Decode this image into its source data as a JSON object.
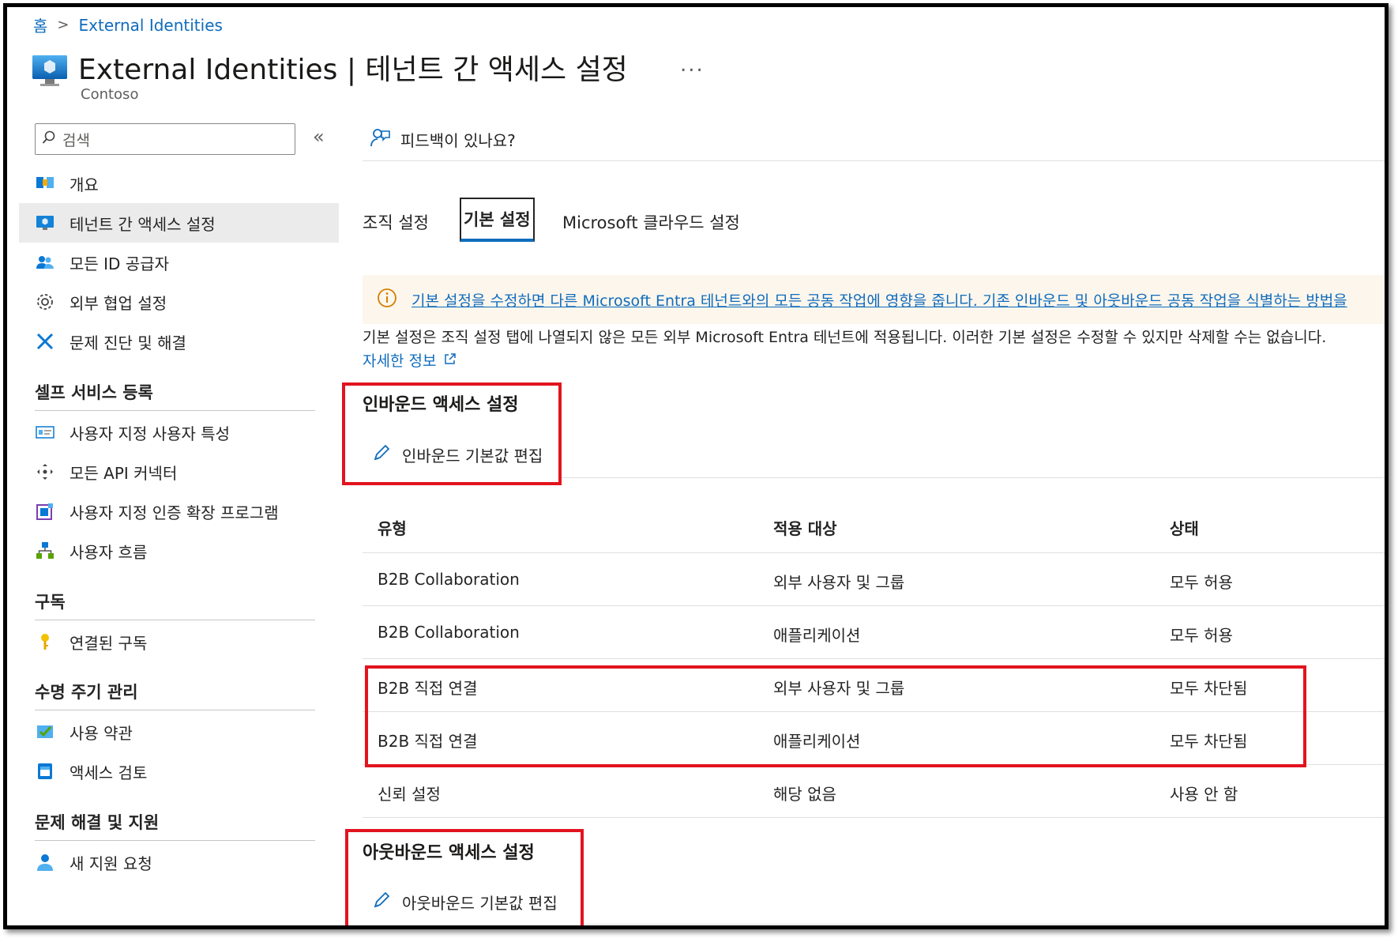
{
  "breadcrumb": {
    "home": "홈",
    "current": "External Identities"
  },
  "header": {
    "title": "External Identities | 테넌트 간 액세스 설정",
    "more": "...",
    "subtitle": "Contoso"
  },
  "sidebar": {
    "search_placeholder": "검색",
    "collapse": "«",
    "items": [
      {
        "label": "개요",
        "icon": "overview-icon"
      },
      {
        "label": "테넌트 간 액세스 설정",
        "icon": "monitor-icon",
        "active": true
      },
      {
        "label": "모든 ID 공급자",
        "icon": "users-icon"
      },
      {
        "label": "외부 협업 설정",
        "icon": "gear-icon"
      },
      {
        "label": "문제 진단 및 해결",
        "icon": "wrench-icon"
      }
    ],
    "sections": [
      {
        "title": "셀프 서비스 등록",
        "items": [
          {
            "label": "사용자 지정 사용자 특성",
            "icon": "attributes-icon"
          },
          {
            "label": "모든 API 커넥터",
            "icon": "connector-icon"
          },
          {
            "label": "사용자 지정 인증 확장 프로그램",
            "icon": "extension-icon"
          },
          {
            "label": "사용자 흐름",
            "icon": "flow-icon"
          }
        ]
      },
      {
        "title": "구독",
        "items": [
          {
            "label": "연결된 구독",
            "icon": "key-icon"
          }
        ]
      },
      {
        "title": "수명 주기 관리",
        "items": [
          {
            "label": "사용 약관",
            "icon": "checklist-icon"
          },
          {
            "label": "액세스 검토",
            "icon": "review-icon"
          }
        ]
      },
      {
        "title": "문제 해결 및 지원",
        "items": [
          {
            "label": "새 지원 요청",
            "icon": "support-icon"
          }
        ]
      }
    ]
  },
  "feedback": {
    "label": "피드백이 있나요?"
  },
  "tabs": [
    {
      "label": "조직 설정"
    },
    {
      "label": "기본 설정",
      "selected": true
    },
    {
      "label": "Microsoft 클라우드 설정"
    }
  ],
  "banner": {
    "text": "기본 설정을 수정하면 다른 Microsoft Entra 테넌트와의 모든 공동 작업에 영향을 줍니다. 기존 인바운드 및 아웃바운드 공동 작업을 식별하는 방법을"
  },
  "description": "기본 설정은 조직 설정 탭에 나열되지 않은 모든 외부 Microsoft Entra 테넌트에 적용됩니다. 이러한 기본 설정은 수정할 수 있지만 삭제할 수는 없습니다.",
  "learn_more": "자세한 정보",
  "inbound": {
    "title": "인바운드 액세스 설정",
    "edit": "인바운드 기본값 편집"
  },
  "outbound": {
    "title": "아웃바운드 액세스 설정",
    "edit": "아웃바운드 기본값 편집"
  },
  "table": {
    "headers": [
      "유형",
      "적용 대상",
      "상태"
    ],
    "rows": [
      [
        "B2B Collaboration",
        "외부 사용자 및 그룹",
        "모두 허용"
      ],
      [
        "B2B Collaboration",
        "애플리케이션",
        "모두 허용"
      ],
      [
        "B2B 직접 연결",
        "외부 사용자 및 그룹",
        "모두 차단됨"
      ],
      [
        "B2B 직접 연결",
        "애플리케이션",
        "모두 차단됨"
      ],
      [
        "신뢰 설정",
        "해당 없음",
        "사용 안 함"
      ]
    ]
  },
  "colors": {
    "accent": "#0f6cbd",
    "highlight": "#e2141f",
    "banner_bg": "#fdf6ec",
    "active_nav": "#ebebeb"
  }
}
